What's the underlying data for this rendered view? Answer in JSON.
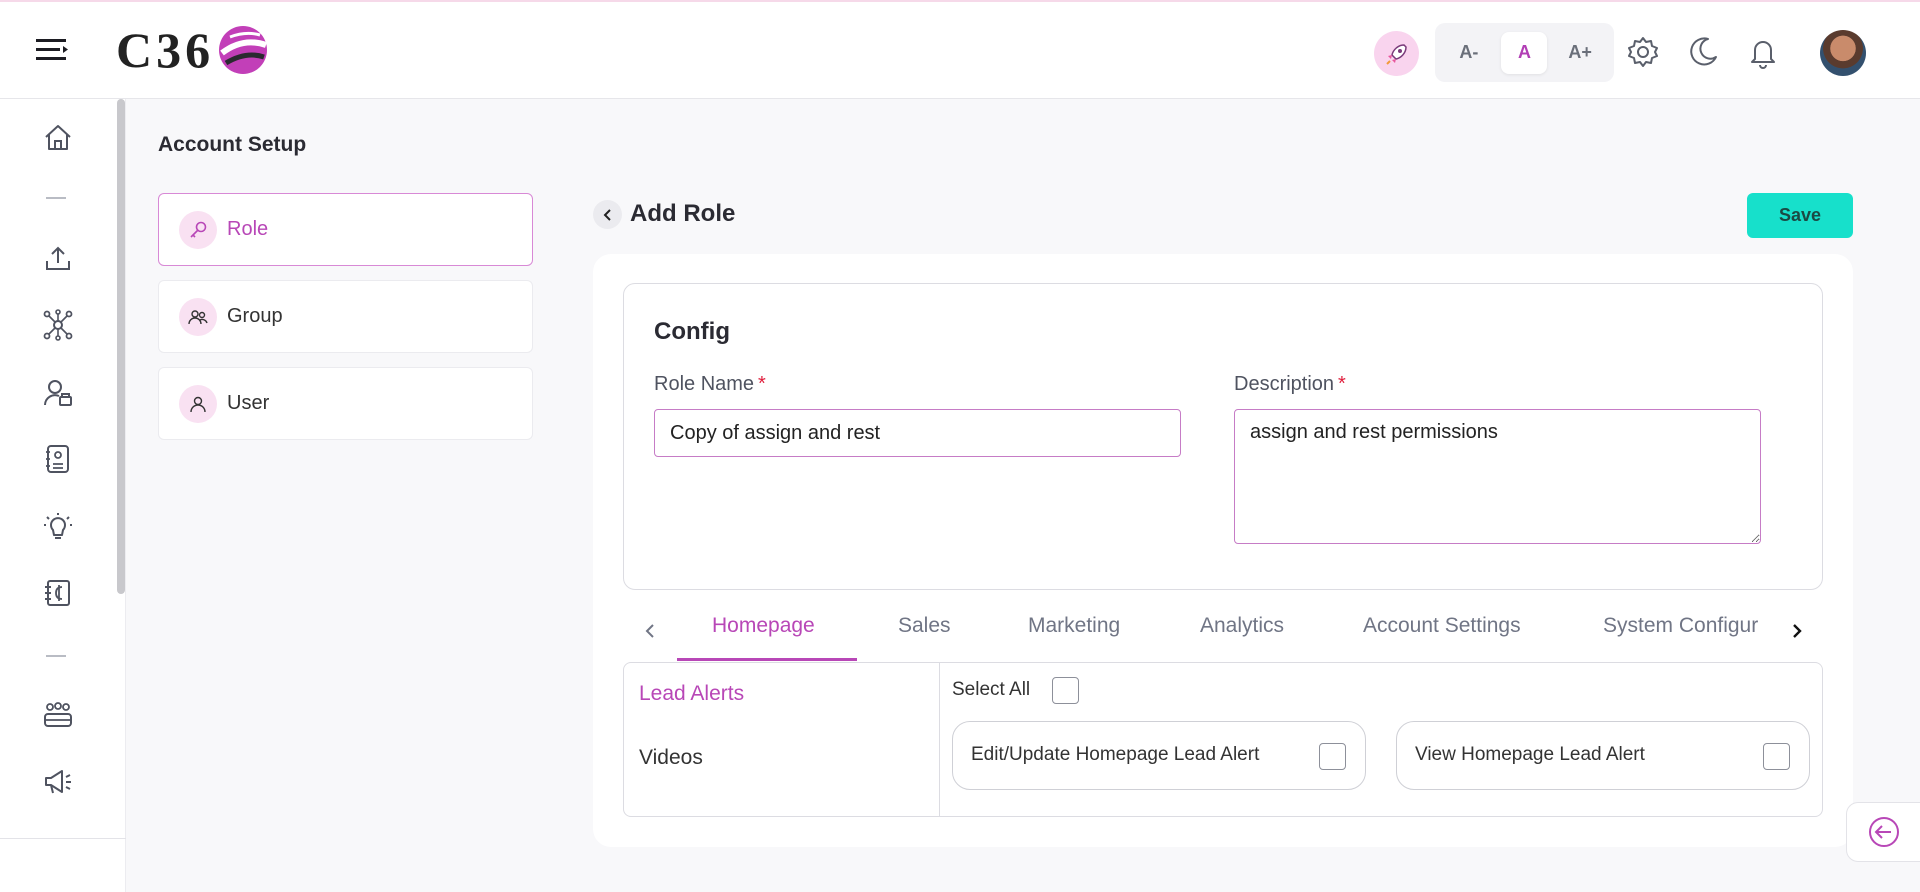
{
  "header": {
    "logo_text": "C36",
    "font_controls": [
      "A-",
      "A",
      "A+"
    ],
    "active_font": "A"
  },
  "page": {
    "title": "Account Setup"
  },
  "nav": {
    "items": [
      {
        "label": "Role",
        "icon": "key-icon",
        "active": true
      },
      {
        "label": "Group",
        "icon": "group-icon",
        "active": false
      },
      {
        "label": "User",
        "icon": "user-icon",
        "active": false
      }
    ]
  },
  "form": {
    "heading": "Add Role",
    "save_label": "Save",
    "config_title": "Config",
    "role_name_label": "Role Name",
    "role_name_value": "Copy of assign and rest",
    "description_label": "Description",
    "description_value": "assign and rest permissions",
    "required_mark": "*"
  },
  "tabs": {
    "items": [
      "Homepage",
      "Sales",
      "Marketing",
      "Analytics",
      "Account Settings",
      "System Configur"
    ],
    "active": "Homepage"
  },
  "permissions": {
    "categories": [
      "Lead Alerts",
      "Videos"
    ],
    "active_category": "Lead Alerts",
    "select_all_label": "Select All",
    "items": [
      {
        "label": "Edit/Update Homepage Lead Alert",
        "checked": false
      },
      {
        "label": "View Homepage Lead Alert",
        "checked": false
      }
    ]
  },
  "colors": {
    "accent": "#b847b7",
    "save": "#17e0cb",
    "required": "#e01e3c"
  }
}
